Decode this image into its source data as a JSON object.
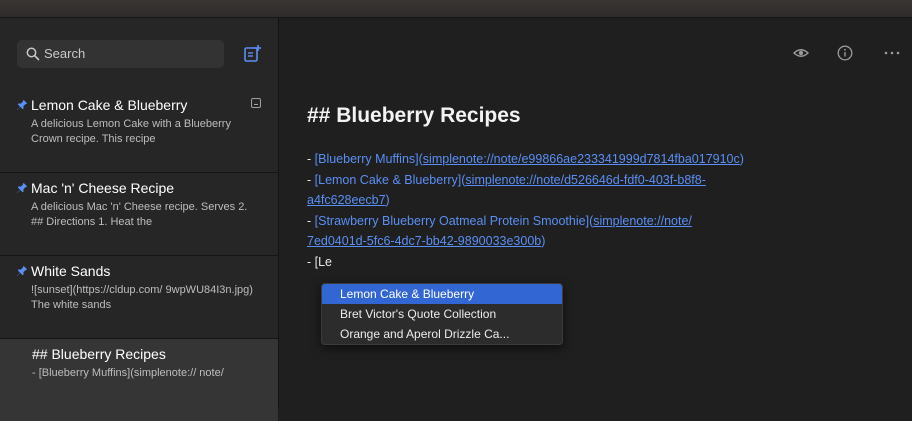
{
  "search": {
    "placeholder": "Search"
  },
  "notes": [
    {
      "title": "Lemon Cake & Blueberry",
      "preview": "A delicious Lemon Cake with a Blueberry Crown recipe. This recipe",
      "pinned": true,
      "markdown": true
    },
    {
      "title": "Mac 'n' Cheese Recipe",
      "preview": "A delicious Mac 'n' Cheese recipe. Serves 2. ## Directions 1. Heat the",
      "pinned": true
    },
    {
      "title": "White Sands",
      "preview": "![sunset](https://cldup.com/ 9wpWU84I3n.jpg) The white sands",
      "pinned": true
    },
    {
      "title": "## Blueberry Recipes",
      "preview": "- [Blueberry Muffins](simplenote:// note/",
      "pinned": false,
      "selected": true
    }
  ],
  "editor": {
    "heading": "## Blueberry Recipes",
    "lines": [
      {
        "prefix": "- ",
        "link": "[Blueberry Muffins]",
        "open": "(",
        "url": "simplenote://note/e99866ae233341999d7814fba017910c",
        "close": ")"
      },
      {
        "prefix": "- ",
        "link": "[Lemon Cake & Blueberry]",
        "open": "(",
        "url_line1": "simplenote://note/d526646d-fdf0-403f-b8f8-",
        "url_line2": "a4fc628eecb7",
        "close": ")"
      },
      {
        "prefix": "- ",
        "link": "[Strawberry Blueberry Oatmeal Protein Smoothie]",
        "open": "(",
        "url_line1": "simplenote://note/",
        "url_line2": "7ed0401d-5fc6-4dc7-bb42-9890033e300b",
        "close": ")"
      }
    ],
    "typing": "- [Le"
  },
  "autocomplete": [
    "Lemon Cake & Blueberry",
    "Bret Victor's Quote Collection",
    "Orange and Aperol Drizzle Ca..."
  ],
  "toolbar": {
    "icons": [
      "eye-icon",
      "info-icon",
      "more-icon"
    ]
  },
  "colors": {
    "accent": "#3266d3",
    "link": "#5a8ff5",
    "pin": "#5a8ff5"
  }
}
